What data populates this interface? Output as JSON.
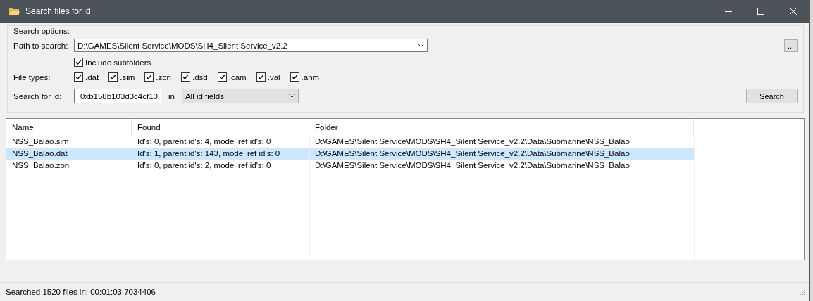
{
  "window": {
    "title": "Search files for id"
  },
  "search_options": {
    "title": "Search options:",
    "path": {
      "label": "Path to search:",
      "value": "D:\\GAMES\\Silent Service\\MODS\\SH4_Silent Service_v2.2",
      "browse": "..."
    },
    "include_subfolders": {
      "label": "Include subfolders",
      "checked": true
    },
    "file_types": {
      "label": "File types:",
      "items": [
        {
          "label": ".dat",
          "checked": true
        },
        {
          "label": ".sim",
          "checked": true
        },
        {
          "label": ".zon",
          "checked": true
        },
        {
          "label": ".dsd",
          "checked": true
        },
        {
          "label": ".cam",
          "checked": true
        },
        {
          "label": ".val",
          "checked": true
        },
        {
          "label": ".anm",
          "checked": true
        }
      ]
    },
    "search_id": {
      "label": "Search for id:",
      "value": "0xb158b103d3c4cf10",
      "in": "in",
      "field": "All id fields"
    },
    "search_button": "Search"
  },
  "table": {
    "columns": [
      "Name",
      "Found",
      "Folder"
    ],
    "rows": [
      {
        "cells": [
          "NSS_Balao.sim",
          "Id's: 0, parent id's: 4, model ref id's: 0",
          "D:\\GAMES\\Silent Service\\MODS\\SH4_Silent Service_v2.2\\Data\\Submarine\\NSS_Balao"
        ],
        "selected": false
      },
      {
        "cells": [
          "NSS_Balao.dat",
          "Id's: 1, parent id's: 143, model ref id's: 0",
          "D:\\GAMES\\Silent Service\\MODS\\SH4_Silent Service_v2.2\\Data\\Submarine\\NSS_Balao"
        ],
        "selected": true
      },
      {
        "cells": [
          "NSS_Balao.zon",
          "Id's: 0, parent id's: 2, model ref id's: 0",
          "D:\\GAMES\\Silent Service\\MODS\\SH4_Silent Service_v2.2\\Data\\Submarine\\NSS_Balao"
        ],
        "selected": false
      }
    ]
  },
  "status_bar": "Searched 1520 files in: 00:01:03.7034406"
}
